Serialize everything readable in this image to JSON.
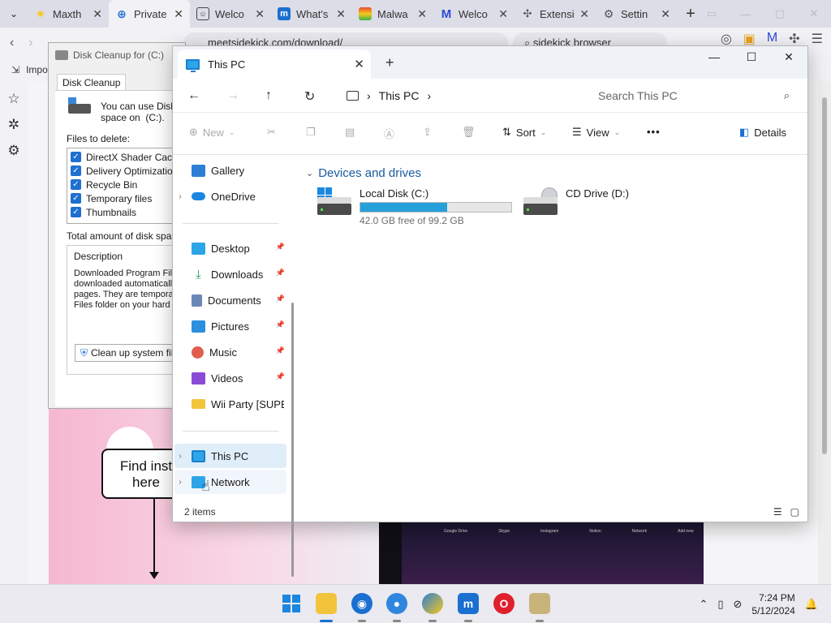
{
  "browser": {
    "tabs": [
      {
        "label": "Maxth",
        "fav_color": "#f7c71c",
        "icon": "sun-icon"
      },
      {
        "label": "Private",
        "fav_color": "#1f6fd0",
        "icon": "globe-icon",
        "active": true
      },
      {
        "label": "Welco",
        "fav_color": "#444444",
        "icon": "smiley-icon"
      },
      {
        "label": "What's",
        "fav_color": "#1a6fd0",
        "icon": "m-logo-icon"
      },
      {
        "label": "Malwa",
        "fav_color": "#e64a2e",
        "icon": "rainbow-icon"
      },
      {
        "label": "Welco",
        "fav_color": "#2b4bd6",
        "icon": "malwarebytes-icon"
      },
      {
        "label": "Extensi",
        "fav_color": "#555555",
        "icon": "puzzle-icon"
      },
      {
        "label": "Settin",
        "fav_color": "#555555",
        "icon": "gear-icon"
      }
    ],
    "url": "meetsidekick.com/download/",
    "search": "sidekick browser",
    "bookmark": "Impo",
    "page": {
      "callout": "Find inst\nhere",
      "strip": [
        "Google Drive",
        "Skype",
        "Instagram",
        "Notion",
        "Network",
        "Add new"
      ]
    }
  },
  "disk_cleanup": {
    "title": "Disk Cleanup for  (C:)",
    "tab": "Disk Cleanup",
    "intro": "You can use Disk (\nspace on  (C:).",
    "files_label": "Files to delete:",
    "files": [
      "DirectX Shader Cac",
      "Delivery Optimizatio",
      "Recycle Bin",
      "Temporary files",
      "Thumbnails"
    ],
    "total_label": "Total amount of disk space",
    "description_heading": "Description",
    "description_text": "Downloaded Program Files\ndownloaded automatically\npages. They are temporari\nFiles folder on your hard d",
    "cleanup_button": "Clean up system file"
  },
  "explorer": {
    "tab_title": "This PC",
    "breadcrumb": "This PC",
    "search_placeholder": "Search This PC",
    "commands": {
      "new": "New",
      "sort": "Sort",
      "view": "View",
      "more": "•••",
      "details": "Details"
    },
    "nav": {
      "gallery": "Gallery",
      "onedrive": "OneDrive",
      "desktop": "Desktop",
      "downloads": "Downloads",
      "documents": "Documents",
      "pictures": "Pictures",
      "music": "Music",
      "videos": "Videos",
      "folder": "Wii Party [SUPE(",
      "thispc": "This PC",
      "network": "Network"
    },
    "group_header": "Devices and drives",
    "drives": [
      {
        "name": "Local Disk (C:)",
        "free": "42.0 GB free of 99.2 GB",
        "used_fraction": 0.577
      },
      {
        "name": "CD Drive (D:)"
      }
    ],
    "status": "2 items"
  },
  "taskbar": {
    "time": "7:24 PM",
    "date": "5/12/2024"
  }
}
